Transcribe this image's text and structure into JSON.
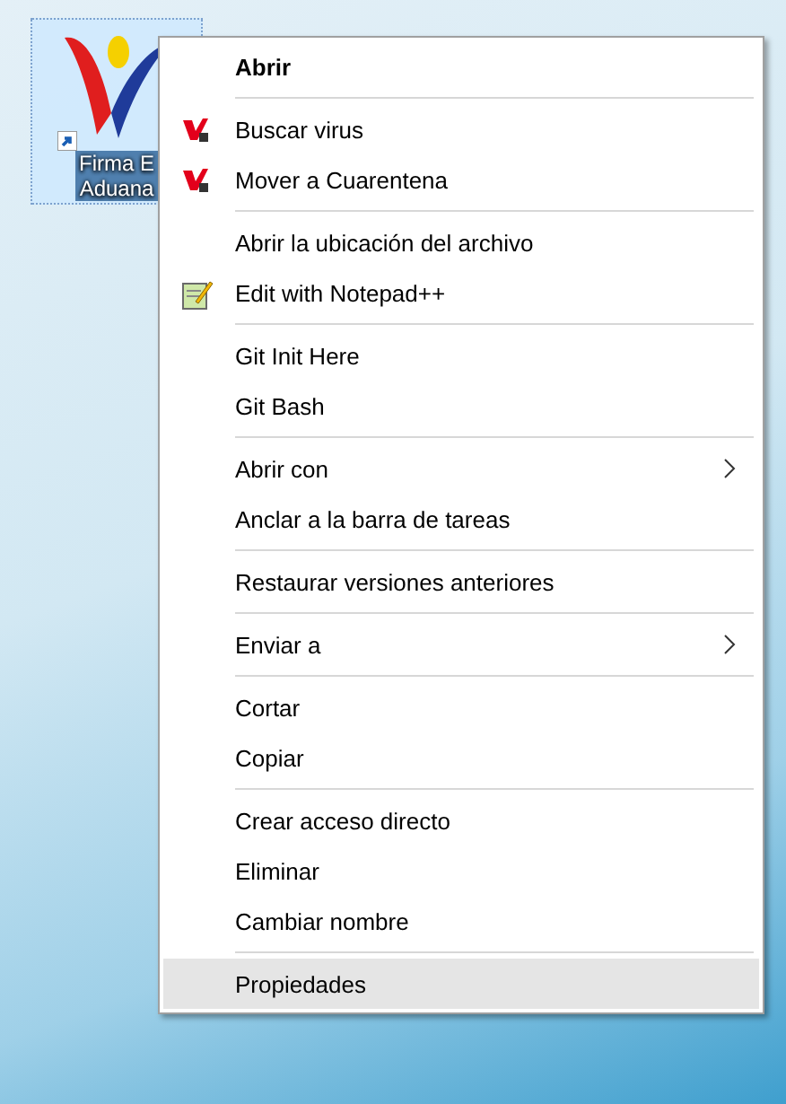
{
  "desktop_icon": {
    "label_lines": [
      "Firma E",
      "Aduana"
    ],
    "selected": true
  },
  "context_menu": {
    "groups": [
      [
        {
          "label": "Abrir",
          "kind": "plain",
          "default": true,
          "selected": false
        }
      ],
      [
        {
          "label": "Buscar virus",
          "kind": "scan",
          "default": false,
          "selected": false
        },
        {
          "label": "Mover a Cuarentena",
          "kind": "scan",
          "default": false,
          "selected": false
        }
      ],
      [
        {
          "label": "Abrir la ubicación del archivo",
          "kind": "plain",
          "default": false,
          "selected": false
        },
        {
          "label": "Edit with Notepad++",
          "kind": "editor",
          "default": false,
          "selected": false
        }
      ],
      [
        {
          "label": "Git Init Here",
          "kind": "plain",
          "default": false,
          "selected": false
        },
        {
          "label": "Git Bash",
          "kind": "plain",
          "default": false,
          "selected": false
        }
      ],
      [
        {
          "label": "Abrir con",
          "kind": "submenu",
          "default": false,
          "selected": false
        },
        {
          "label": "Anclar a la barra de tareas",
          "kind": "plain",
          "default": false,
          "selected": false
        }
      ],
      [
        {
          "label": "Restaurar versiones anteriores",
          "kind": "plain",
          "default": false,
          "selected": false
        }
      ],
      [
        {
          "label": "Enviar a",
          "kind": "submenu",
          "default": false,
          "selected": false
        }
      ],
      [
        {
          "label": "Cortar",
          "kind": "plain",
          "default": false,
          "selected": false
        },
        {
          "label": "Copiar",
          "kind": "plain",
          "default": false,
          "selected": false
        }
      ],
      [
        {
          "label": "Crear acceso directo",
          "kind": "plain",
          "default": false,
          "selected": false
        },
        {
          "label": "Eliminar",
          "kind": "plain",
          "default": false,
          "selected": false
        },
        {
          "label": "Cambiar nombre",
          "kind": "plain",
          "default": false,
          "selected": false
        }
      ],
      [
        {
          "label": "Propiedades",
          "kind": "plain",
          "default": false,
          "selected": true
        }
      ]
    ]
  }
}
